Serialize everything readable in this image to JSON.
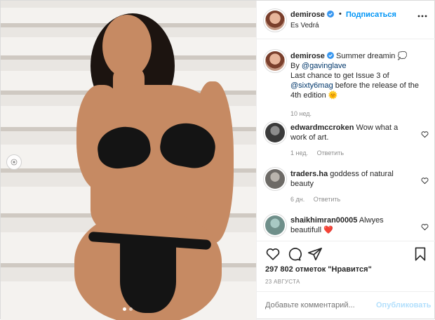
{
  "post": {
    "username": "demirose",
    "follow_label": "Подписаться",
    "location": "Es Vedrá",
    "caption": {
      "text_main": "Summer dreamin 💭",
      "by_label": "By",
      "mention_photographer": "@gavinglave",
      "line2": "Last chance to get Issue 3 of",
      "mention_mag": "@sixty6mag",
      "line3": "before the release of the",
      "line4": "4th edition 🌞",
      "time": "10 нед."
    },
    "comments": [
      {
        "username": "edwardmccroken",
        "text": "Wow what a work of art.",
        "time": "1 нед.",
        "reply": "Ответить"
      },
      {
        "username": "traders.ha",
        "text": "goddess of natural beauty",
        "time": "6 дн.",
        "reply": "Ответить"
      },
      {
        "username": "shaikhimran00005",
        "text": "Alwyes beautifull ❤️",
        "time": "",
        "reply": ""
      }
    ],
    "likes_text": "297 802 отметок \"Нравится\"",
    "date": "23 августа",
    "comment_placeholder": "Добавьте комментарий...",
    "publish_label": "Опубликовать"
  },
  "icons": {
    "like": "heart-icon",
    "comment": "comment-icon",
    "share": "share-icon",
    "save": "bookmark-icon",
    "more": "more-dots-icon",
    "verified": "verified-badge-icon",
    "prev": "chevron-left-icon"
  },
  "carousel": {
    "slides": 2,
    "active": 1
  },
  "colors": {
    "link": "#00376b",
    "follow": "#0095f6",
    "verified": "#3897f0",
    "publish_disabled": "#b2dffc"
  }
}
